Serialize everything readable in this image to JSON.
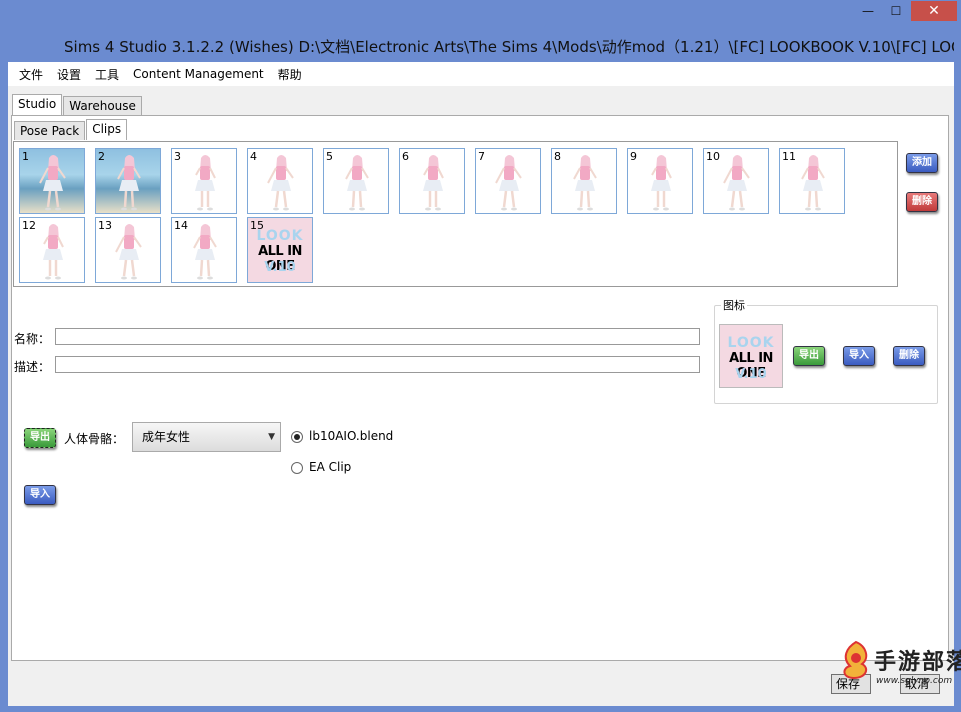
{
  "window": {
    "title": "Sims 4 Studio 3.1.2.2 (Wishes)  D:\\文档\\Electronic Arts\\The Sims 4\\Mods\\动作mod（1.21）\\[FC] LOOKBOOK V.10\\[FC] LOOKBOOK",
    "minimize": "—",
    "maximize": "☐",
    "close": "✕"
  },
  "menu": [
    "文件",
    "设置",
    "工具",
    "Content Management",
    "帮助"
  ],
  "main_tabs": [
    "Studio",
    "Warehouse"
  ],
  "sub_tabs": [
    "Pose Pack",
    "Clips"
  ],
  "clips": {
    "items": [
      "1",
      "2",
      "3",
      "4",
      "5",
      "6",
      "7",
      "8",
      "9",
      "10",
      "11",
      "12",
      "13",
      "14",
      "15"
    ],
    "add_label": "添加",
    "delete_label": "删除"
  },
  "thumb_art": {
    "ghost_top": "LOOK",
    "main": "ALL IN ONE",
    "ghost_bottom": "V.10"
  },
  "form": {
    "name_label": "名称：",
    "name_value": "",
    "desc_label": "描述：",
    "desc_value": ""
  },
  "icon_group": {
    "title": "图标",
    "export_label": "导出",
    "import_label": "导入",
    "delete_label": "删除"
  },
  "export_section": {
    "export_label": "导出",
    "skeleton_label": "人体骨骼：",
    "skeleton_value": "成年女性",
    "radio_blend": "lb10AIO.blend",
    "radio_ea": "EA Clip",
    "import_label": "导入"
  },
  "bottom": {
    "save_label": "保存",
    "cancel_label": "取消"
  },
  "watermark": {
    "cn": "手游部落",
    "url": "www.sglynp.com"
  },
  "colors": {
    "titlebar": "#6b8bd0",
    "close": "#c7504a",
    "thumb_border": "#7ea8d8"
  }
}
